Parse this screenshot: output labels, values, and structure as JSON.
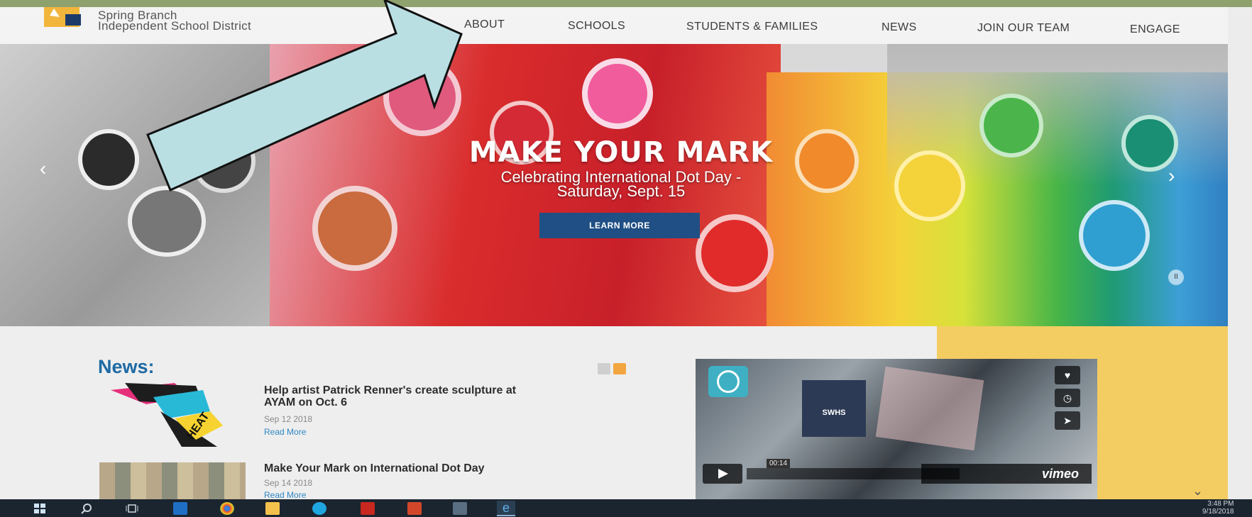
{
  "site": {
    "logo_line1": "Spring Branch",
    "logo_line2": "Independent School District"
  },
  "nav": {
    "items": [
      "ABOUT",
      "SCHOOLS",
      "STUDENTS & FAMILIES",
      "NEWS",
      "JOIN OUR TEAM",
      "ENGAGE"
    ]
  },
  "hero": {
    "title": "MAKE YOUR MARK",
    "subtitle_line1": "Celebrating International Dot Day -",
    "subtitle_line2": "Saturday, Sept. 15",
    "button_label": "LEARN MORE",
    "prev_glyph": "‹",
    "next_glyph": "›",
    "pause_glyph": "II"
  },
  "news": {
    "heading": "News:",
    "items": [
      {
        "title_line1": "Help artist Patrick Renner's create sculpture at",
        "title_line2": "AYAM on Oct. 6",
        "date": "Sep 12 2018",
        "more": "Read More"
      },
      {
        "title_line1": "Make Your Mark on International Dot Day",
        "title_line2": "",
        "date": "Sep 14 2018",
        "more": "Read More"
      }
    ],
    "thumb_text": "HEAT"
  },
  "video": {
    "time": "00:14",
    "brand": "vimeo",
    "shirt_text": "SWHS"
  },
  "taskbar": {
    "time": "3:48 PM",
    "date": "9/18/2018"
  },
  "colors": {
    "brand_blue": "#1d6aa3",
    "button_blue": "#1f4f84",
    "accent_yellow": "#f3cd62",
    "annotation_arrow": "#b9dfe3"
  }
}
